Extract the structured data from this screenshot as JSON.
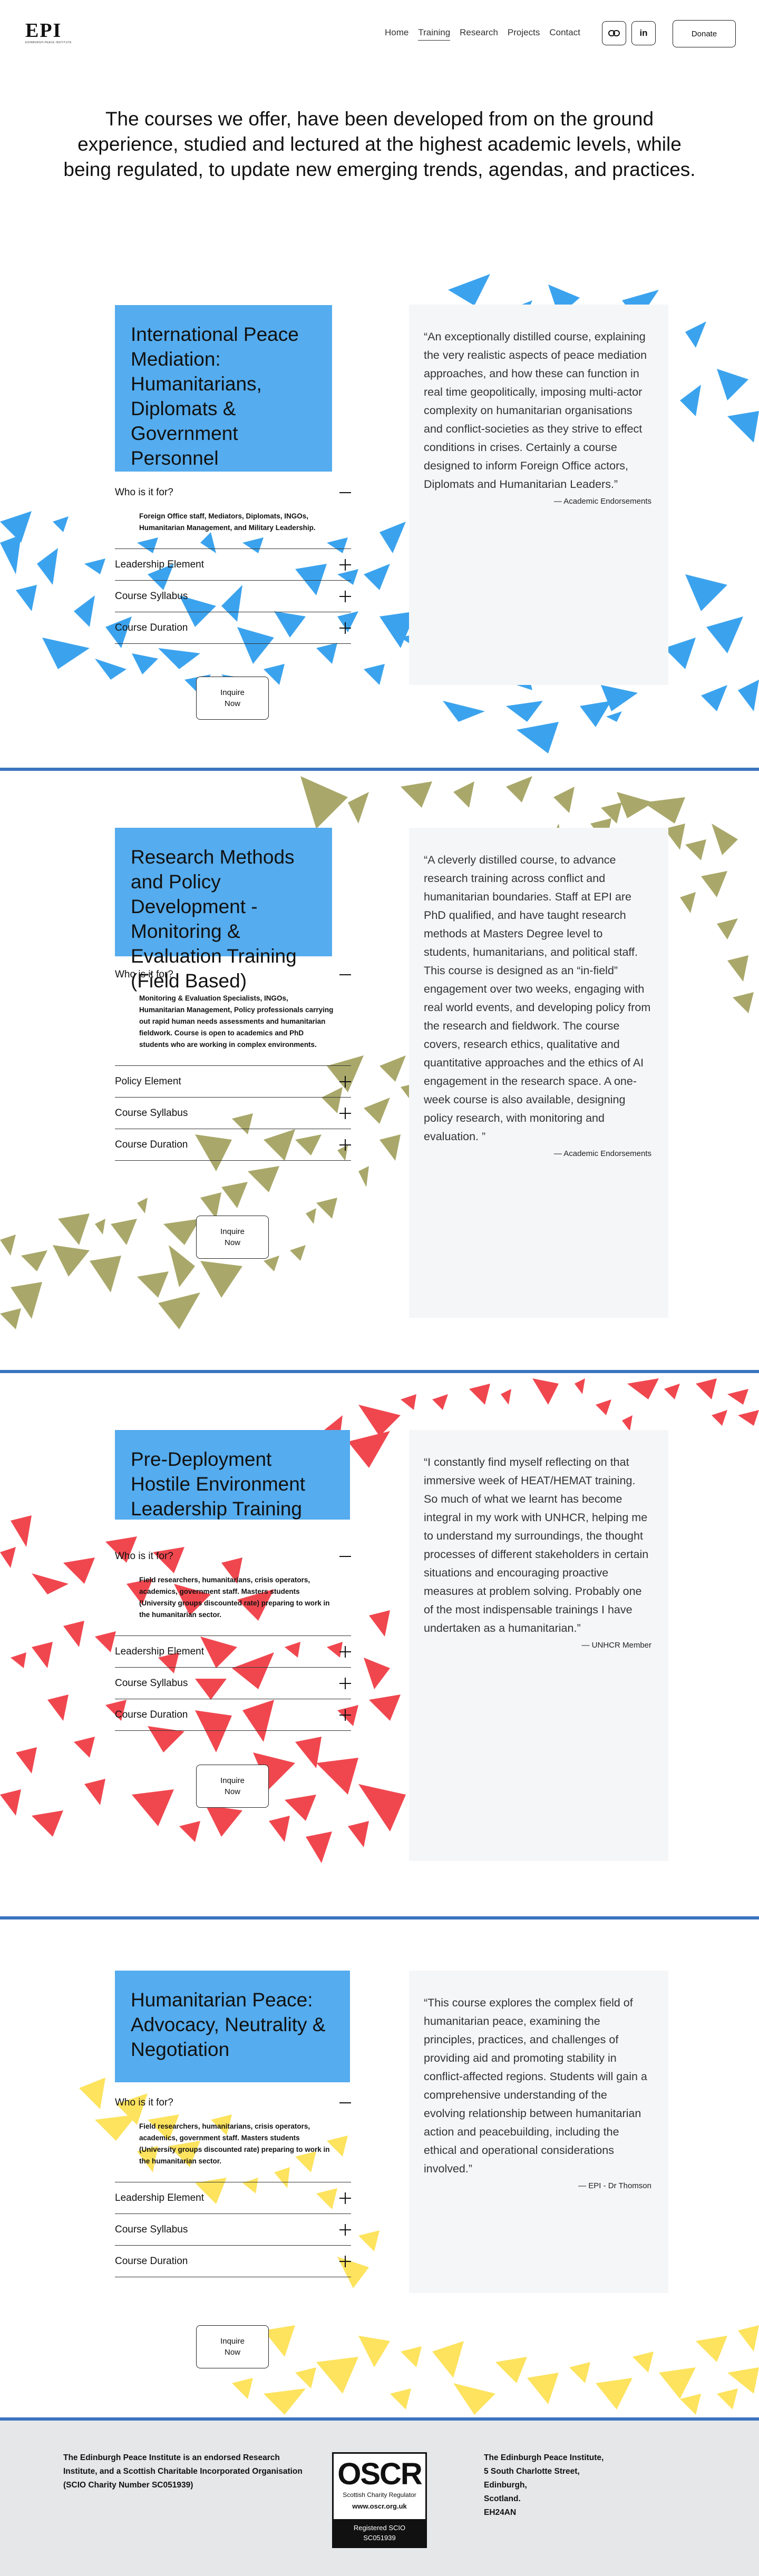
{
  "header": {
    "logo_text": "EPI",
    "logo_subtitle": "EDINBURGH PEACE INSTITUTE",
    "nav": [
      "Home",
      "Training",
      "Research",
      "Projects",
      "Contact"
    ],
    "active_nav": "Training",
    "social": [
      {
        "icon": "link-icon",
        "glyph": "∞"
      },
      {
        "icon": "linkedin-icon",
        "glyph": "in"
      }
    ],
    "donate_label": "Donate"
  },
  "intro": "The courses we offer, have been developed from on the ground experience, studied and lectured at the highest academic levels, while being regulated, to update new emerging trends, agendas, and practices.",
  "colors": {
    "card_blue": "#55acee",
    "divider": "#3a74c0",
    "shapes": [
      "#3ba3ee",
      "#a9a86a",
      "#f0474f",
      "#fde35e"
    ]
  },
  "courses": [
    {
      "title": "International Peace Mediation: Humanitarians, Diplomats & Government Personnel",
      "who_label": "Who is it for?",
      "who_text": "Foreign Office staff, Mediators, Diplomats, INGOs, Humanitarian Management, and Military Leadership.",
      "items": [
        "Leadership Element",
        "Course Syllabus",
        "Course Duration"
      ],
      "inquire": [
        "Inquire",
        "Now"
      ],
      "quote": "“An exceptionally distilled course, explaining the very realistic aspects of peace mediation approaches, and how these can function in real time geopolitically, imposing multi-actor complexity on humanitarian organisations and conflict-societies as they strive to effect conditions in crises. Certainly a course designed to inform Foreign Office actors, Diplomats and Humanitarian Leaders.”",
      "attribution": "— Academic Endorsements"
    },
    {
      "title": "Research Methods and Policy Development - Monitoring & Evaluation Training (Field Based)",
      "who_label": "Who is it for?",
      "who_text": "Monitoring & Evaluation Specialists, INGOs, Humanitarian Management, Policy professionals carrying out rapid human needs assessments and humanitarian fieldwork. Course is open to academics and PhD students who are working in complex environments.",
      "items": [
        "Policy Element",
        "Course Syllabus",
        "Course Duration"
      ],
      "inquire": [
        "Inquire",
        "Now"
      ],
      "quote": "“A cleverly distilled course, to advance research training across conflict and humanitarian boundaries. Staff at EPI are PhD qualified, and have taught research methods at Masters Degree level to students, humanitarians, and political staff. This course is designed as an “in-field” engagement over two weeks, engaging with real world events, and developing policy from the research and fieldwork. The course covers, research ethics, qualitative and quantitative approaches and the ethics of AI engagement in the research space. A one-week course is also available, designing policy research, with monitoring and evaluation. ”",
      "attribution": "— Academic Endorsements"
    },
    {
      "title": "Pre-Deployment Hostile Environment Leadership Training",
      "who_label": "Who is it for?",
      "who_text": "Field researchers, humanitarians, crisis operators, academics, government staff. Masters students (University groups discounted rate) preparing to work in the humanitarian sector.",
      "items": [
        "Leadership Element",
        "Course Syllabus",
        "Course Duration"
      ],
      "inquire": [
        "Inquire",
        "Now"
      ],
      "quote": "“I constantly find myself reflecting on that immersive week of HEAT/HEMAT training. So much of what we learnt has become integral in my work with UNHCR, helping me to understand my surroundings, the thought processes of different stakeholders in certain situations and encouraging proactive measures at problem solving. Probably one of the most indispensable trainings I have undertaken as a humanitarian.”",
      "attribution": "— UNHCR Member"
    },
    {
      "title": "Humanitarian Peace: Advocacy, Neutrality & Negotiation",
      "who_label": "Who is it for?",
      "who_text": "Field researchers, humanitarians, crisis operators, academics, government staff. Masters students (University groups discounted rate) preparing to work in the humanitarian sector.",
      "items": [
        "Leadership Element",
        "Course Syllabus",
        "Course Duration"
      ],
      "inquire": [
        "Inquire",
        "Now"
      ],
      "quote": "“This course explores the complex field of humanitarian peace, examining the principles, practices, and challenges of providing aid and promoting stability in conflict-affected regions. Students will gain a comprehensive understanding of the evolving relationship between humanitarian action and peacebuilding, including the ethical and operational considerations involved.”",
      "attribution": "— EPI - Dr Thomson"
    }
  ],
  "footer": {
    "left_text": "The Edinburgh Peace Institute is an endorsed Research Institute, and a Scottish Charitable Incorporated Organisation (SCIO Charity Number SC051939)",
    "oscr_title": "OSCR",
    "oscr_sub": "Scottish Charity Regulator",
    "oscr_url": "www.oscr.org.uk",
    "oscr_band_line1": "Registered SCIO",
    "oscr_band_line2": "SC051939",
    "address": [
      "The Edinburgh Peace Institute,",
      "5 South Charlotte Street,",
      "Edinburgh,",
      "Scotland.",
      "EH24AN"
    ]
  }
}
